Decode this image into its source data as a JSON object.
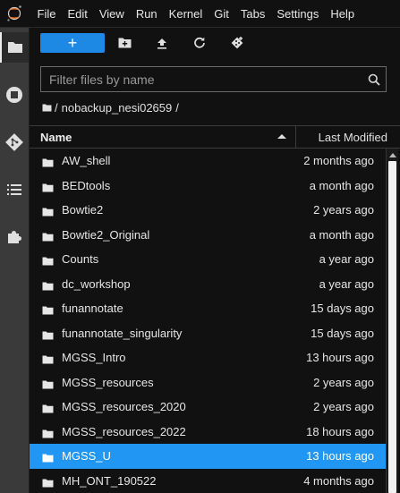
{
  "menu": [
    "File",
    "Edit",
    "View",
    "Run",
    "Kernel",
    "Git",
    "Tabs",
    "Settings",
    "Help"
  ],
  "logo_icon": "jupyter-logo-icon",
  "sidebar_icons": [
    "folder-icon",
    "running-stop-icon",
    "git-icon",
    "table-of-contents-icon",
    "extension-puzzle-icon"
  ],
  "toolbar": {
    "new_label": "+",
    "new_folder_icon": "new-folder-icon",
    "upload_icon": "upload-icon",
    "refresh_icon": "refresh-icon",
    "git_clone_icon": "git-clone-icon"
  },
  "filter": {
    "placeholder": "Filter files by name",
    "value": ""
  },
  "breadcrumb": {
    "folder": "nobackup_nesi02659",
    "sep_before": "/",
    "sep_after": "/"
  },
  "header": {
    "name": "Name",
    "modified": "Last Modified",
    "sort": "ascending"
  },
  "files": [
    {
      "name": "AW_shell",
      "modified": "2 months ago"
    },
    {
      "name": "BEDtools",
      "modified": "a month ago"
    },
    {
      "name": "Bowtie2",
      "modified": "2 years ago"
    },
    {
      "name": "Bowtie2_Original",
      "modified": "a month ago"
    },
    {
      "name": "Counts",
      "modified": "a year ago"
    },
    {
      "name": "dc_workshop",
      "modified": "a year ago"
    },
    {
      "name": "funannotate",
      "modified": "15 days ago"
    },
    {
      "name": "funannotate_singularity",
      "modified": "15 days ago"
    },
    {
      "name": "MGSS_Intro",
      "modified": "13 hours ago"
    },
    {
      "name": "MGSS_resources",
      "modified": "2 years ago"
    },
    {
      "name": "MGSS_resources_2020",
      "modified": "2 years ago"
    },
    {
      "name": "MGSS_resources_2022",
      "modified": "18 hours ago"
    },
    {
      "name": "MGSS_U",
      "modified": "13 hours ago",
      "selected": true
    },
    {
      "name": "MH_ONT_190522",
      "modified": "4 months ago"
    }
  ],
  "colors": {
    "accent": "#1e88e5",
    "selected_row": "#2196f3",
    "logo": "#f37726"
  }
}
